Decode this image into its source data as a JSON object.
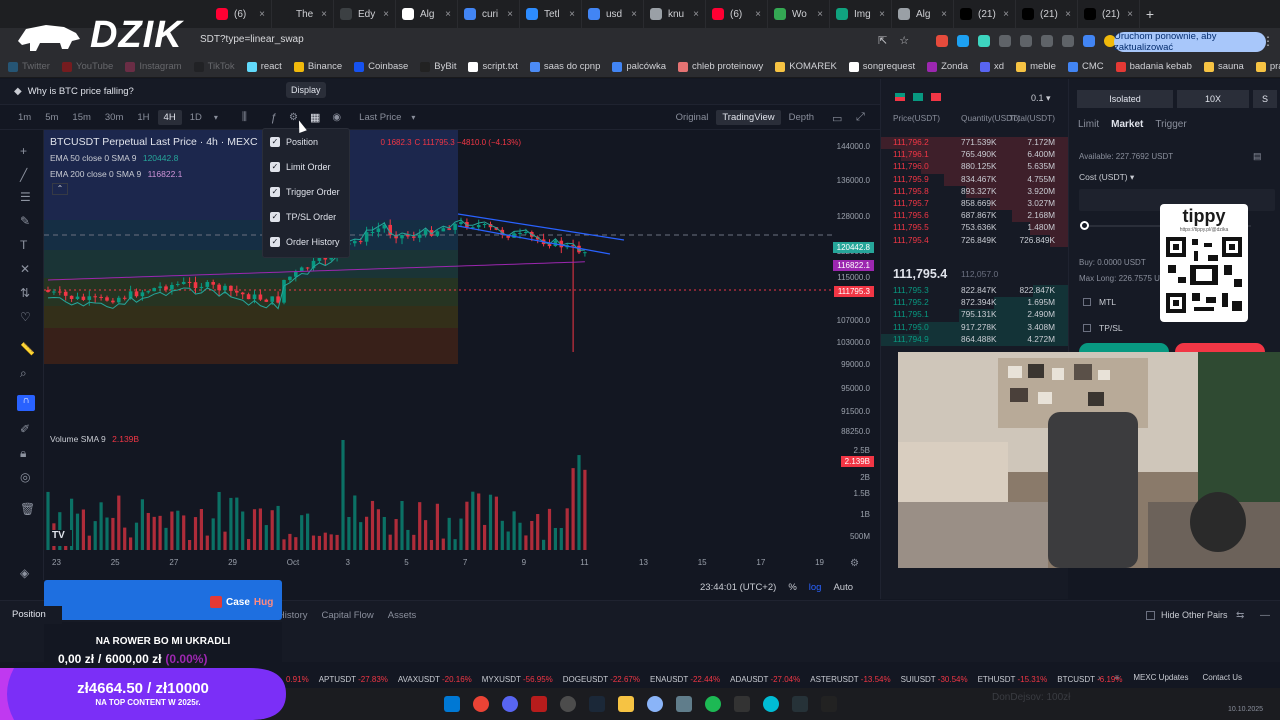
{
  "browser": {
    "tabs": [
      {
        "label": "(6)",
        "color": "#ff0033"
      },
      {
        "label": "The",
        "color": "#1e1f22"
      },
      {
        "label": "Edy",
        "color": "#3c4043"
      },
      {
        "label": "Alg",
        "color": "#ffffff"
      },
      {
        "label": "curi",
        "color": "#4285f4"
      },
      {
        "label": "Tetl",
        "color": "#2d8cff"
      },
      {
        "label": "usd",
        "color": "#4285f4"
      },
      {
        "label": "knu",
        "color": "#9aa0a6"
      },
      {
        "label": "(6)",
        "color": "#ff0033"
      },
      {
        "label": "Wo",
        "color": "#34a853"
      },
      {
        "label": "Img",
        "color": "#10a37f"
      },
      {
        "label": "Alg",
        "color": "#9aa0a6"
      },
      {
        "label": "(21)",
        "color": "#000000"
      },
      {
        "label": "(21)",
        "color": "#000000"
      },
      {
        "label": "(21)",
        "color": "#000000"
      }
    ],
    "url": "SDT?type=linear_swap",
    "update_button": "Uruchom ponownie, aby zaktualizować",
    "bookmarks": [
      "Twitter",
      "YouTube",
      "Instagram",
      "TikTok",
      "react",
      "Binance",
      "Coinbase",
      "ByBit",
      "script.txt",
      "saas do cpnp",
      "palcówka",
      "chleb proteinowy",
      "KOMAREK",
      "songrequest",
      "Zonda",
      "xd",
      "meble",
      "CMC",
      "badania kebab",
      "sauna",
      "prawo jazdy"
    ]
  },
  "header": {
    "news": "Why is BTC price falling?",
    "tooltip": "Display"
  },
  "toolbar": {
    "timeframes": [
      "1m",
      "5m",
      "15m",
      "30m",
      "1H",
      "4H",
      "1D"
    ],
    "active_timeframe": "4H",
    "price_type": "Last Price",
    "views": [
      "Original",
      "TradingView",
      "Depth"
    ],
    "active_view": "TradingView"
  },
  "display_menu": [
    "Position",
    "Limit Order",
    "Trigger Order",
    "TP/SL Order",
    "Order History"
  ],
  "chart": {
    "symbol": "BTCUSDT Perpetual Last Price · 4h · MEXC",
    "ohlc": "C 111795.3  −4810.0 (−4.13%)",
    "ohlc_prefix": "0 1682.3",
    "ema50": "EMA 50 close 0 SMA 9",
    "ema50_val": "120442.8",
    "ema200": "EMA 200 close 0 SMA 9",
    "ema200_val": "116822.1",
    "volume_label": "Volume SMA 9",
    "volume_val": "2.139B",
    "y_ticks": [
      "144000.0",
      "136000.0",
      "128000.0",
      "122000.0",
      "115000.0",
      "111000.0",
      "107000.0",
      "103000.0",
      "99000.0",
      "95000.0",
      "91500.0",
      "88250.0",
      "2.5B",
      "2B",
      "1.5B",
      "1B",
      "500M"
    ],
    "badges": [
      {
        "label": "120442.8",
        "color": "#26a69a"
      },
      {
        "label": "116822.1",
        "color": "#9c27b0"
      },
      {
        "label": "111795.3",
        "color": "#f23645"
      },
      {
        "label": "2.139B",
        "color": "#f23645"
      }
    ],
    "x_ticks": [
      "23",
      "25",
      "27",
      "29",
      "Oct",
      "3",
      "5",
      "7",
      "9",
      "11",
      "13",
      "15",
      "17",
      "19"
    ],
    "time": "23:44:01 (UTC+2)",
    "scale_percent": "%",
    "scale_log": "log",
    "scale_auto": "Auto",
    "colors": {
      "up": "#089981",
      "down": "#f23645"
    }
  },
  "orderbook": {
    "step": "0.1",
    "headers": [
      "Price(USDT)",
      "Quantity(USDT)",
      "Total(USDT)"
    ],
    "asks": [
      [
        "111,796.2",
        "771.539K",
        "7.172M"
      ],
      [
        "111,796.1",
        "765.490K",
        "6.400M"
      ],
      [
        "111,796.0",
        "880.125K",
        "5.635M"
      ],
      [
        "111,795.9",
        "834.467K",
        "4.755M"
      ],
      [
        "111,795.8",
        "893.327K",
        "3.920M"
      ],
      [
        "111,795.7",
        "858.669K",
        "3.027M"
      ],
      [
        "111,795.6",
        "687.867K",
        "2.168M"
      ],
      [
        "111,795.5",
        "753.636K",
        "1.480M"
      ],
      [
        "111,795.4",
        "726.849K",
        "726.849K"
      ]
    ],
    "last": "111,795.4",
    "mark": "112,057.0",
    "bids": [
      [
        "111,795.3",
        "822.847K",
        "822.847K"
      ],
      [
        "111,795.2",
        "872.394K",
        "1.695M"
      ],
      [
        "111,795.1",
        "795.131K",
        "2.490M"
      ],
      [
        "111,795.0",
        "917.278K",
        "3.408M"
      ],
      [
        "111,794.9",
        "864.488K",
        "4.272M"
      ]
    ]
  },
  "trade": {
    "margin": "Isolated",
    "leverage": "10X",
    "side": "S",
    "tabs": [
      "Limit",
      "Market",
      "Trigger"
    ],
    "active_tab": "Market",
    "available": "Available: 227.7692 USDT",
    "cost_label": "Cost (USDT)",
    "buy": "Buy: 0.0000 USDT",
    "max_long": "Max Long: 226.7575 USDT",
    "mtl": "MTL",
    "tpsl": "TP/SL"
  },
  "bottom": {
    "tabs": [
      "Position",
      "e History",
      "Capital Flow",
      "Assets"
    ],
    "hide_other": "Hide Other Pairs"
  },
  "ticker": [
    {
      "sym": "",
      "chg": "0.91%"
    },
    {
      "sym": "APTUSDT",
      "chg": "-27.83%"
    },
    {
      "sym": "AVAXUSDT",
      "chg": "-20.16%"
    },
    {
      "sym": "MYXUSDT",
      "chg": "-56.95%"
    },
    {
      "sym": "DOGEUSDT",
      "chg": "-22.67%"
    },
    {
      "sym": "ENAUSDT",
      "chg": "-22.44%"
    },
    {
      "sym": "ADAUSDT",
      "chg": "-27.04%"
    },
    {
      "sym": "ASTERUSDT",
      "chg": "-13.54%"
    },
    {
      "sym": "SUIUSDT",
      "chg": "-30.54%"
    },
    {
      "sym": "ETHUSDT",
      "chg": "-15.31%"
    },
    {
      "sym": "BTCUSDT",
      "chg": "-6.19%"
    }
  ],
  "ticker_right": {
    "updates": "MEXC Updates",
    "contact": "Contact Us"
  },
  "overlays": {
    "brand": "DZIK",
    "tippy": "tippy",
    "tippy_url": "https://tippy.pl/@dzika",
    "donate_brand": "Case",
    "donate_brand2": "Hug",
    "donate_title": "NA ROWER BO MI UKRADLI",
    "donate_amount": "0,00 zł",
    "donate_goal": "6000,00 zł",
    "donate_pct": "(0.00%)",
    "goal_amount": "zł4664.50 / zł10000",
    "goal_sub": "NA TOP CONTENT W 2025r.",
    "donor": "DonDejsov: 100zł",
    "date": "10.10.2025"
  }
}
